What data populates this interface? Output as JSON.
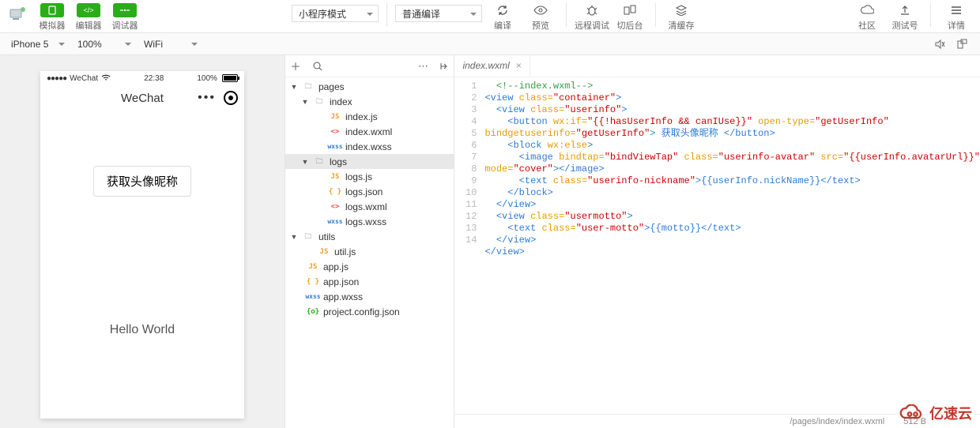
{
  "toolbar": {
    "simulator": "模拟器",
    "editor": "编辑器",
    "debugger": "调试器",
    "mode_select": "小程序模式",
    "compile_select": "普通编译",
    "compile": "编译",
    "preview": "预览",
    "remote_debug": "远程调试",
    "background": "切后台",
    "clear_cache": "清缓存",
    "community": "社区",
    "test_account": "测试号",
    "detail": "详情"
  },
  "devicebar": {
    "device": "iPhone 5",
    "zoom": "100%",
    "network": "WiFi"
  },
  "phone": {
    "carrier": "WeChat",
    "time": "22:38",
    "battery": "100%",
    "title": "WeChat",
    "avatar_btn": "获取头像昵称",
    "hello": "Hello World"
  },
  "tree": {
    "pages": "pages",
    "index": "index",
    "index_js": "index.js",
    "index_wxml": "index.wxml",
    "index_wxss": "index.wxss",
    "logs": "logs",
    "logs_js": "logs.js",
    "logs_json": "logs.json",
    "logs_wxml": "logs.wxml",
    "logs_wxss": "logs.wxss",
    "utils": "utils",
    "util_js": "util.js",
    "app_js": "app.js",
    "app_json": "app.json",
    "app_wxss": "app.wxss",
    "project_config": "project.config.json"
  },
  "editor": {
    "tab_name": "index.wxml",
    "status_path": "/pages/index/index.wxml",
    "status_size": "512 B",
    "lines": [
      "1",
      "2",
      "3",
      "4",
      "",
      "5",
      "6",
      "",
      "7",
      "8",
      "9",
      "10",
      "11",
      "12",
      "13",
      "14"
    ]
  },
  "code": {
    "l1": "  <!--index.wxml-->",
    "l2a": "<view ",
    "l2b": "class=",
    "l2c": "\"container\"",
    "l2d": ">",
    "l3a": "  <view ",
    "l3b": "class=",
    "l3c": "\"userinfo\"",
    "l3d": ">",
    "l4a": "    <button ",
    "l4b": "wx:if=",
    "l4c": "\"{{!hasUserInfo && canIUse}}\" ",
    "l4d": "open-type=",
    "l4e": "\"getUserInfo\"",
    "l4f": "bindgetuserinfo=",
    "l4g": "\"getUserInfo\"",
    "l4h": "> 获取头像昵称 </button>",
    "l5a": "    <block ",
    "l5b": "wx:else",
    "l5c": ">",
    "l6a": "      <image ",
    "l6b": "bindtap=",
    "l6c": "\"bindViewTap\" ",
    "l6d": "class=",
    "l6e": "\"userinfo-avatar\" ",
    "l6f": "src=",
    "l6g": "\"{{userInfo.avatarUrl}}\"",
    "l6h": "mode=",
    "l6i": "\"cover\"",
    "l6j": "></image>",
    "l7a": "      <text ",
    "l7b": "class=",
    "l7c": "\"userinfo-nickname\"",
    "l7d": ">{{userInfo.nickName}}</text>",
    "l8": "    </block>",
    "l9": "  </view>",
    "l10a": "  <view ",
    "l10b": "class=",
    "l10c": "\"usermotto\"",
    "l10d": ">",
    "l11a": "    <text ",
    "l11b": "class=",
    "l11c": "\"user-motto\"",
    "l11d": ">{{motto}}</text>",
    "l12": "  </view>",
    "l13": "</view>",
    "l14": ""
  },
  "brand": "亿速云"
}
